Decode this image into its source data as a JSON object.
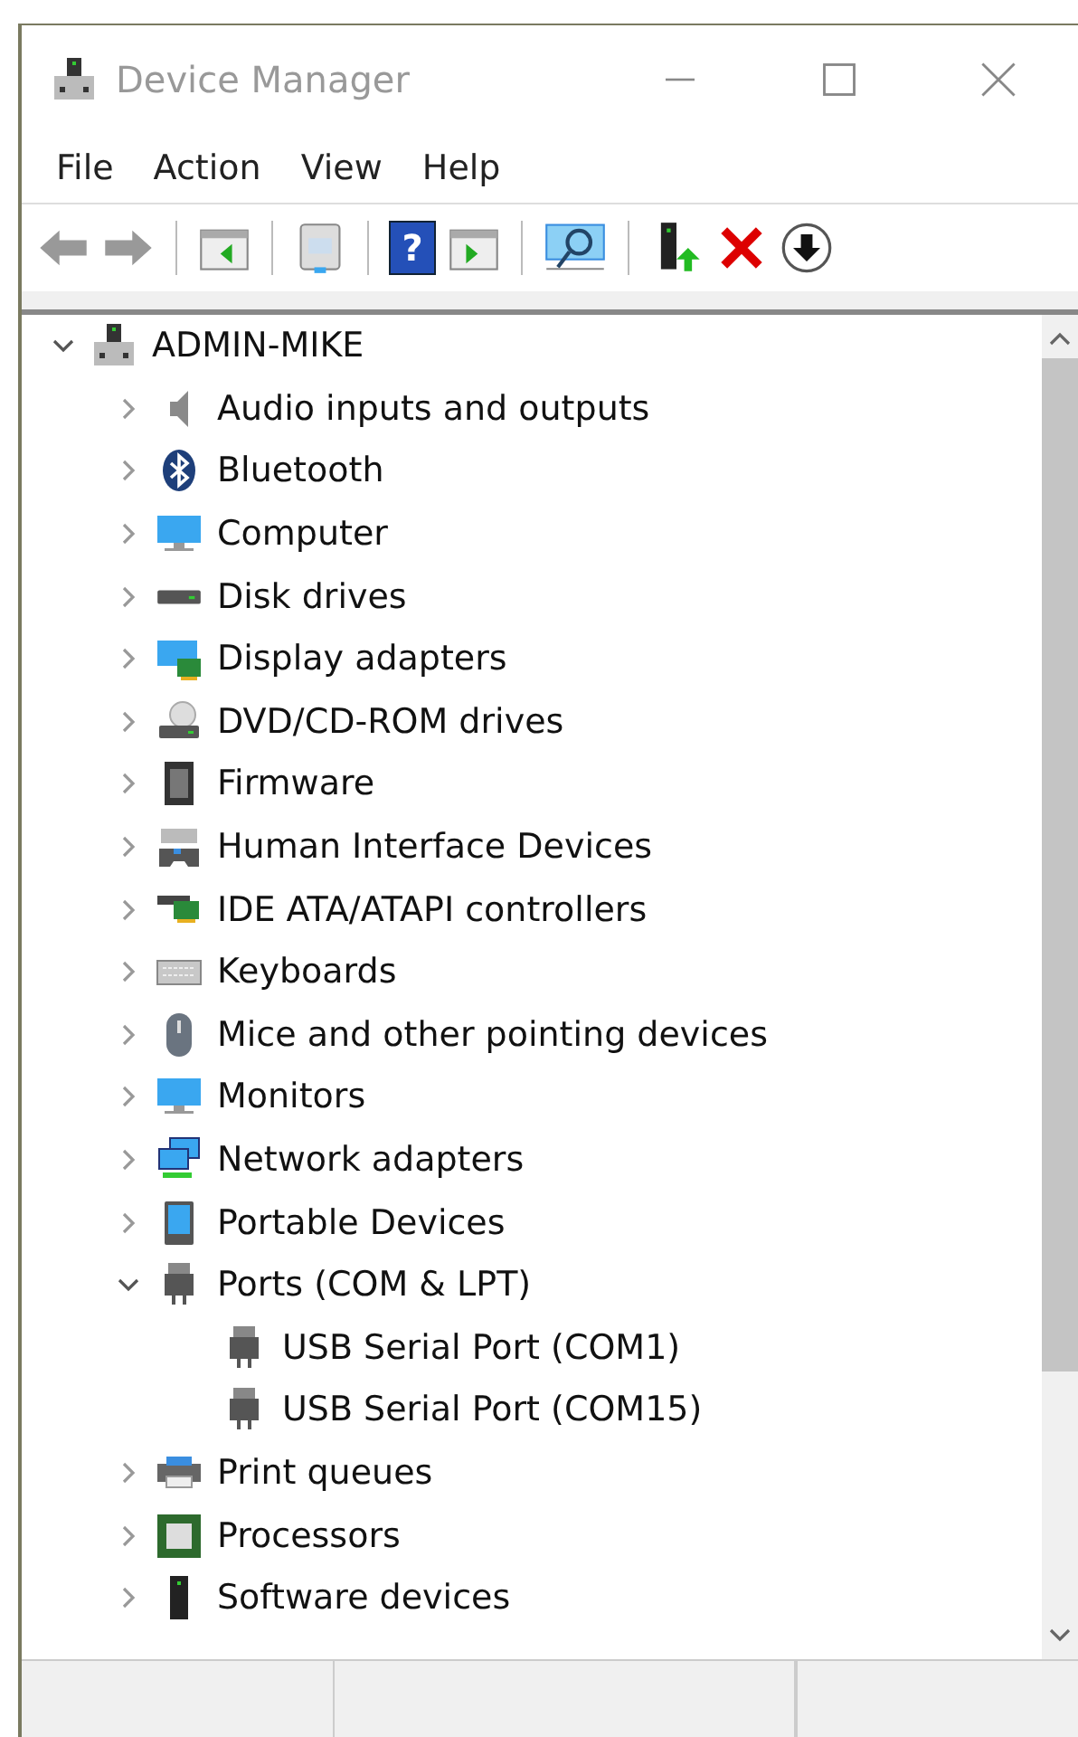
{
  "window": {
    "title": "Device Manager"
  },
  "menu": [
    "File",
    "Action",
    "View",
    "Help"
  ],
  "toolbar": [
    {
      "kind": "back"
    },
    {
      "kind": "forward"
    },
    {
      "kind": "sep"
    },
    {
      "kind": "pane-left"
    },
    {
      "kind": "sep"
    },
    {
      "kind": "sheet"
    },
    {
      "kind": "sep"
    },
    {
      "kind": "help",
      "glyph": "?"
    },
    {
      "kind": "pane-right"
    },
    {
      "kind": "sep"
    },
    {
      "kind": "scan"
    },
    {
      "kind": "sep"
    },
    {
      "kind": "add"
    },
    {
      "kind": "remove"
    },
    {
      "kind": "down"
    }
  ],
  "tree": {
    "label": "ADMIN-MIKE",
    "expanded": true,
    "children": [
      {
        "label": "Audio inputs and outputs",
        "expanded": false
      },
      {
        "label": "Bluetooth",
        "expanded": false
      },
      {
        "label": "Computer",
        "expanded": false
      },
      {
        "label": "Disk drives",
        "expanded": false
      },
      {
        "label": "Display adapters",
        "expanded": false
      },
      {
        "label": "DVD/CD-ROM drives",
        "expanded": false
      },
      {
        "label": "Firmware",
        "expanded": false
      },
      {
        "label": "Human Interface Devices",
        "expanded": false
      },
      {
        "label": "IDE ATA/ATAPI controllers",
        "expanded": false
      },
      {
        "label": "Keyboards",
        "expanded": false
      },
      {
        "label": "Mice and other pointing devices",
        "expanded": false
      },
      {
        "label": "Monitors",
        "expanded": false
      },
      {
        "label": "Network adapters",
        "expanded": false
      },
      {
        "label": "Portable Devices",
        "expanded": false
      },
      {
        "label": "Ports (COM & LPT)",
        "expanded": true,
        "children": [
          {
            "label": "USB Serial Port (COM1)"
          },
          {
            "label": "USB Serial Port (COM15)"
          }
        ]
      },
      {
        "label": "Print queues",
        "expanded": false
      },
      {
        "label": "Processors",
        "expanded": false
      },
      {
        "label": "Software devices",
        "expanded": false
      }
    ]
  }
}
